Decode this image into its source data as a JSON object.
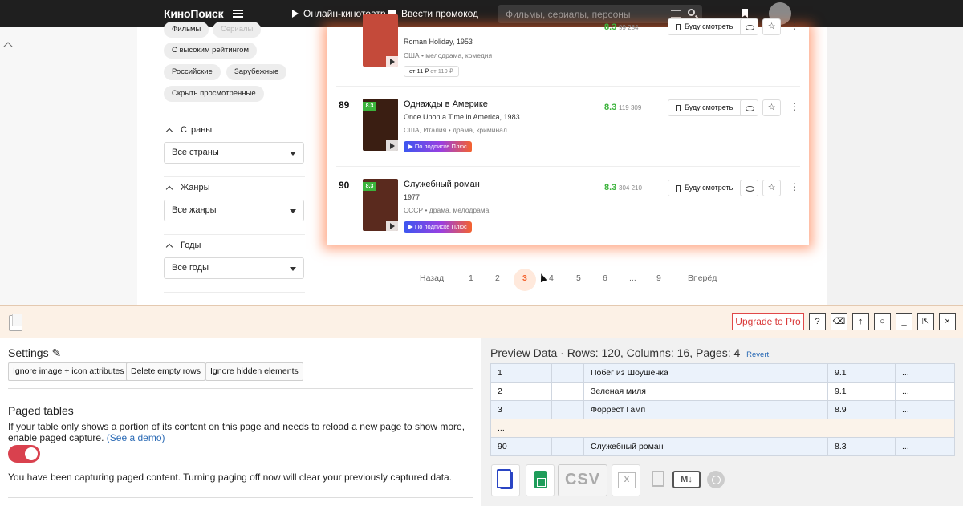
{
  "topnav": {
    "logo": "КиноПоиск",
    "online": "Онлайн-кинотеатр",
    "promo": "Ввести промокод",
    "search_placeholder": "Фильмы, сериалы, персоны"
  },
  "filters": {
    "chips": [
      "Фильмы",
      "Сериалы",
      "С высоким рейтингом",
      "Российские",
      "Зарубежные",
      "Скрыть просмотренные"
    ],
    "sections": [
      {
        "title": "Страны",
        "value": "Все страны"
      },
      {
        "title": "Жанры",
        "value": "Все жанры"
      },
      {
        "title": "Годы",
        "value": "Все годы"
      }
    ]
  },
  "films": [
    {
      "rank": "",
      "title": "",
      "original": "Roman Holiday, 1953",
      "meta": "США • мелодрама, комедия",
      "price_prefix": "от 11 ₽",
      "price_old": "от 119 ₽",
      "rating": "8.3",
      "votes": "99 284",
      "watch": "Буду смотреть",
      "poster_color": "#c44a3a"
    },
    {
      "rank": "89",
      "title": "Однажды в Америке",
      "original": "Once Upon a Time in America, 1983",
      "meta": "США, Италия • драма, криминал",
      "badge": "▶ По подписке Плюс",
      "rating": "8.3",
      "votes": "119 309",
      "watch": "Буду смотреть",
      "poster_badge": "8.3",
      "poster_color": "#3a1e12"
    },
    {
      "rank": "90",
      "title": "Служебный роман",
      "original": "1977",
      "meta": "СССР • драма, мелодрама",
      "badge": "▶ По подписке Плюс",
      "rating": "8.3",
      "votes": "304 210",
      "watch": "Буду смотреть",
      "poster_badge": "8.3",
      "poster_color": "#5a2a1e"
    }
  ],
  "pagination": {
    "prev": "Назад",
    "pages": [
      "1",
      "2",
      "3",
      "4",
      "5",
      "6",
      "...",
      "9"
    ],
    "active": "3",
    "next": "Вперёд"
  },
  "extension": {
    "upgrade": "Upgrade to Pro",
    "toolbar": [
      "?",
      "⌫",
      "↑",
      "○",
      "_",
      "⇱",
      "×"
    ],
    "settings_title": "Settings ✎",
    "buttons": [
      "Ignore image + icon attributes",
      "Delete empty rows",
      "Ignore hidden elements"
    ],
    "paged_title": "Paged tables",
    "paged_text": "If your table only shows a portion of its content on this page and needs to reload a new page to show more, enable paged capture.",
    "paged_link": "(See a demo)",
    "paged_warning": "You have been capturing paged content. Turning paging off now will clear your previously captured data.",
    "preview_title": "Preview Data · Rows: 120, Columns: 16, Pages: 4",
    "revert": "Revert",
    "csv": "CSV",
    "md": "M↓",
    "rows": [
      [
        "1",
        "",
        "Побег из Шоушенка",
        "9.1",
        "..."
      ],
      [
        "2",
        "",
        "Зеленая миля",
        "9.1",
        "..."
      ],
      [
        "3",
        "",
        "Форрест Гамп",
        "8.9",
        "..."
      ],
      [
        "...",
        "",
        "",
        "",
        ""
      ],
      [
        "90",
        "",
        "Служебный роман",
        "8.3",
        "..."
      ]
    ]
  },
  "colors": {
    "accent": "#f4622e",
    "rating_green": "#3bb33b",
    "toggle_on": "#d9414e"
  }
}
